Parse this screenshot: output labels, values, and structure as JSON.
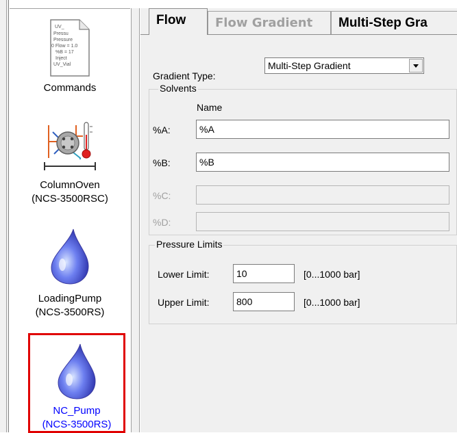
{
  "sidebar": {
    "commands_icon_lines": [
      "UV_",
      "Pressu",
      "Pressure",
      "0 Flow = 1.0",
      "%B = 17",
      "Inject",
      "UV_Vial"
    ],
    "items": [
      {
        "label": "Commands"
      },
      {
        "label": "ColumnOven (NCS-3500RSC)",
        "line1": "ColumnOven",
        "line2": "(NCS-3500RSC)"
      },
      {
        "label": "LoadingPump (NCS-3500RS)",
        "line1": "LoadingPump",
        "line2": "(NCS-3500RS)"
      },
      {
        "label": "NC_Pump (NCS-3500RS)",
        "line1": "NC_Pump",
        "line2": "(NCS-3500RS)",
        "selected": true
      }
    ]
  },
  "tabs": [
    {
      "label": "Flow",
      "active": true
    },
    {
      "label": "Flow Gradient",
      "enabled": false
    },
    {
      "label": "Multi-Step Gra"
    }
  ],
  "flow": {
    "gradient_type_label": "Gradient Type:",
    "gradient_type_value": "Multi-Step Gradient",
    "solvents": {
      "title": "Solvents",
      "name_header": "Name",
      "rows": [
        {
          "label": "%A:",
          "value": "%A",
          "enabled": true
        },
        {
          "label": "%B:",
          "value": "%B",
          "enabled": true
        },
        {
          "label": "%C:",
          "value": "",
          "enabled": false
        },
        {
          "label": "%D:",
          "value": "",
          "enabled": false
        }
      ]
    },
    "pressure_limits": {
      "title": "Pressure Limits",
      "lower_label": "Lower Limit:",
      "lower_value": "10",
      "lower_range": "[0...1000 bar]",
      "upper_label": "Upper Limit:",
      "upper_value": "800",
      "upper_range": "[0...1000 bar]"
    }
  },
  "colors": {
    "selection_outline": "#e00000",
    "selected_label": "#0000ff",
    "panel_bg": "#f0f0f0"
  }
}
